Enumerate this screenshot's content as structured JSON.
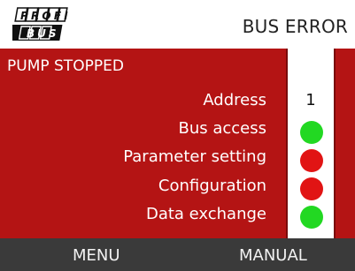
{
  "header": {
    "logo_top": "PROFI",
    "logo_bottom": "BUS",
    "title": "BUS ERROR"
  },
  "status": {
    "message": "PUMP STOPPED"
  },
  "rows": [
    {
      "label": "Address",
      "value": "1"
    },
    {
      "label": "Bus access",
      "state": "ok"
    },
    {
      "label": "Parameter setting",
      "state": "error"
    },
    {
      "label": "Configuration",
      "state": "error"
    },
    {
      "label": "Data exchange",
      "state": "ok"
    }
  ],
  "colors": {
    "ok": "#22d822",
    "error": "#e11414",
    "background": "#b41414"
  },
  "footer": {
    "left_button": "MENU",
    "right_button": "MANUAL"
  }
}
